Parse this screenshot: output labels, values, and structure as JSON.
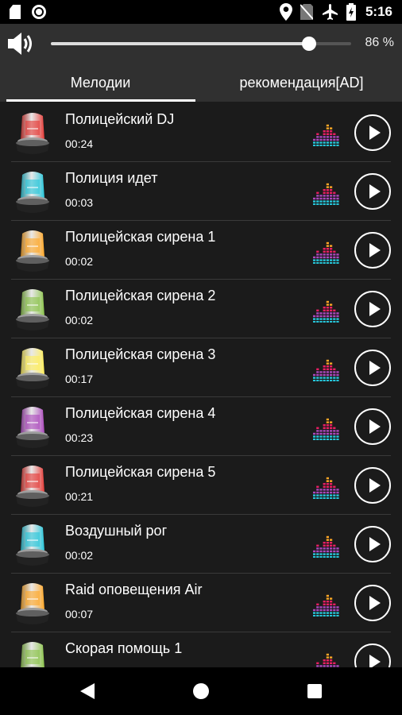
{
  "status_bar": {
    "time": "5:16",
    "icons": [
      "sd-card-icon",
      "record-icon",
      "location-icon",
      "no-sim-icon",
      "airplane-icon",
      "battery-charging-icon"
    ]
  },
  "volume": {
    "icon": "speaker-icon",
    "level": 0.86,
    "label": "86 %"
  },
  "tabs": [
    {
      "label": "Мелодии",
      "selected": true
    },
    {
      "label": "рекомендация[AD]",
      "selected": false
    }
  ],
  "colors": {
    "background": "#1b1b1b",
    "bar": "#303030",
    "accent": "#ffffff",
    "divider": "#3a3a3a"
  },
  "sounds": [
    {
      "title": "Полицейский DJ",
      "duration": "00:24",
      "light_color": "#e53935"
    },
    {
      "title": "Полиция идет",
      "duration": "00:03",
      "light_color": "#26c6da"
    },
    {
      "title": "Полицейская сирена 1",
      "duration": "00:02",
      "light_color": "#ffa726"
    },
    {
      "title": "Полицейская сирена 2",
      "duration": "00:02",
      "light_color": "#8bc34a"
    },
    {
      "title": "Полицейская сирена 3",
      "duration": "00:17",
      "light_color": "#ffee58"
    },
    {
      "title": "Полицейская сирена 4",
      "duration": "00:23",
      "light_color": "#ab47bc"
    },
    {
      "title": "Полицейская сирена 5",
      "duration": "00:21",
      "light_color": "#e53935"
    },
    {
      "title": "Воздушный рог",
      "duration": "00:02",
      "light_color": "#26c6da"
    },
    {
      "title": "Raid оповещения Air",
      "duration": "00:07",
      "light_color": "#ffa726"
    },
    {
      "title": "Скорая помощь 1",
      "duration": "",
      "light_color": "#8bc34a"
    }
  ]
}
